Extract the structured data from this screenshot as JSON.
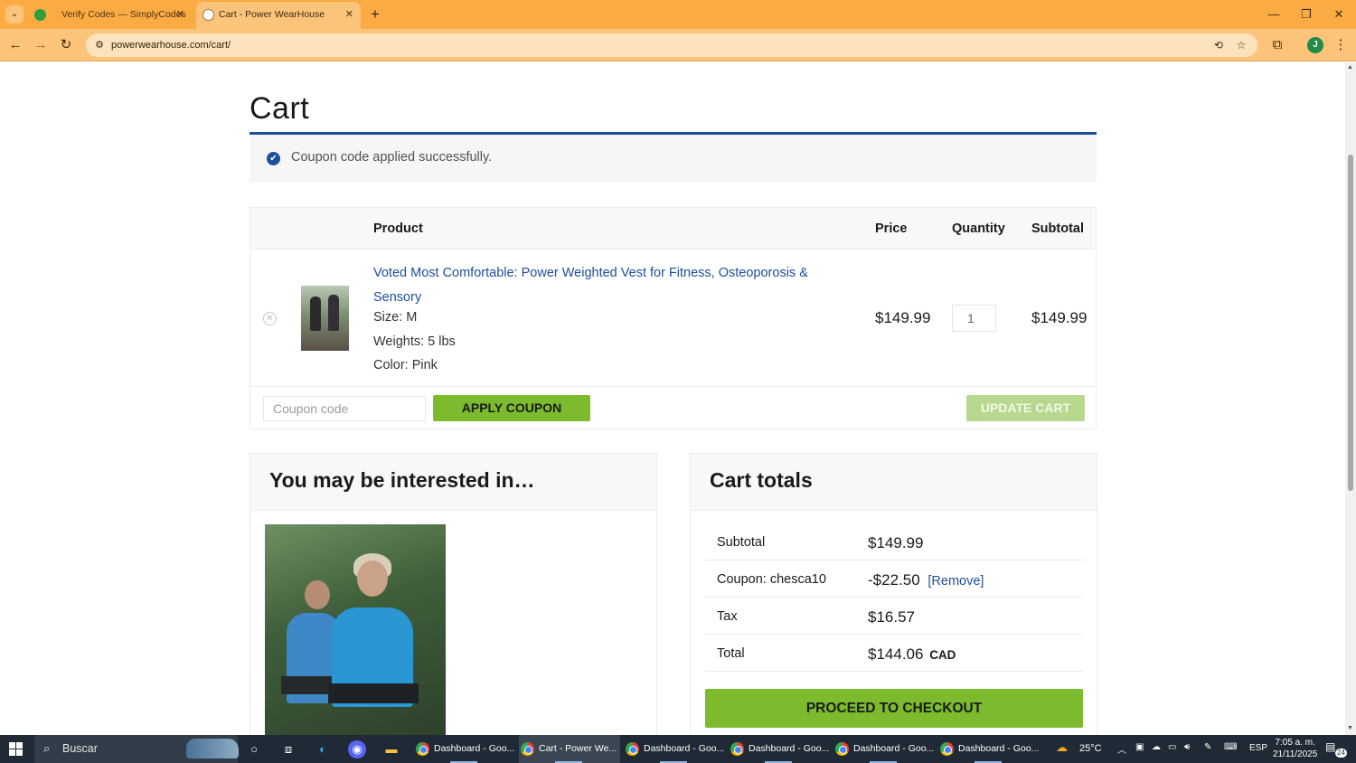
{
  "browser": {
    "tabs": [
      {
        "title": "Verify Codes — SimplyCodes",
        "active": false
      },
      {
        "title": "Cart - Power WearHouse",
        "active": true
      }
    ],
    "url": "powerwearhouse.com/cart/",
    "profile_initial": "J"
  },
  "page": {
    "title": "Cart",
    "notice": "Coupon code applied successfully.",
    "table_headers": {
      "product": "Product",
      "price": "Price",
      "quantity": "Quantity",
      "subtotal": "Subtotal"
    },
    "item": {
      "name": "Voted Most Comfortable: Power Weighted Vest for Fitness, Osteoporosis & Sensory",
      "size": "Size: M",
      "weights": "Weights: 5 lbs",
      "color": "Color: Pink",
      "price": "$149.99",
      "quantity": "1",
      "subtotal": "$149.99"
    },
    "coupon_placeholder": "Coupon code",
    "apply_coupon_label": "APPLY COUPON",
    "update_cart_label": "UPDATE CART",
    "interested_title": "You may be interested in…",
    "totals": {
      "title": "Cart totals",
      "subtotal_label": "Subtotal",
      "subtotal_value": "$149.99",
      "coupon_label": "Coupon: chesca10",
      "coupon_value": "-$22.50",
      "coupon_remove": "[Remove]",
      "tax_label": "Tax",
      "tax_value": "$16.57",
      "total_label": "Total",
      "total_value": "$144.06",
      "currency": "CAD",
      "checkout_label": "PROCEED TO CHECKOUT"
    },
    "colors": {
      "accent_green": "#7cbb2d",
      "link_blue": "#1e4e9c",
      "browser_orange": "#fbab43"
    }
  },
  "taskbar": {
    "search_text": "Buscar",
    "apps": [
      {
        "label": "Dashboard - Goo..."
      },
      {
        "label": "Cart - Power We..."
      },
      {
        "label": "Dashboard - Goo..."
      },
      {
        "label": "Dashboard - Goo..."
      },
      {
        "label": "Dashboard - Goo..."
      },
      {
        "label": "Dashboard - Goo..."
      }
    ],
    "weather": "25°C",
    "language": "ESP",
    "time": "7:05 a. m.",
    "date": "21/11/2025",
    "notification_count": "24"
  }
}
